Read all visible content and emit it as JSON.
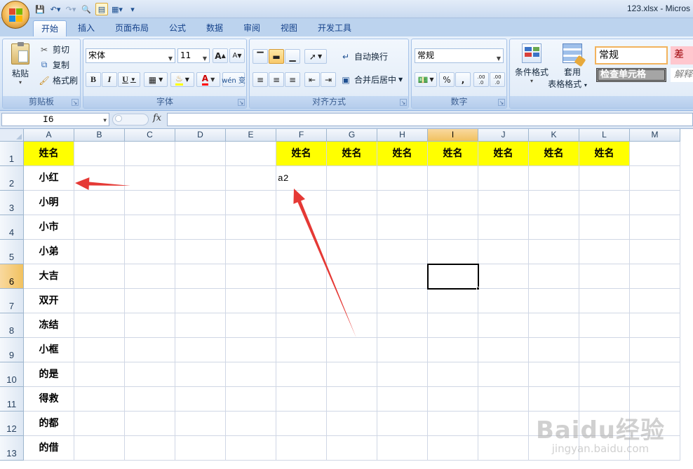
{
  "window": {
    "title": "123.xlsx - Micros"
  },
  "tabs": [
    "开始",
    "插入",
    "页面布局",
    "公式",
    "数据",
    "审阅",
    "视图",
    "开发工具"
  ],
  "active_tab": "开始",
  "ribbon": {
    "clipboard": {
      "label": "剪贴板",
      "paste": "粘贴",
      "cut": "剪切",
      "copy": "复制",
      "format_painter": "格式刷"
    },
    "font": {
      "label": "字体",
      "font_name": "宋体",
      "font_size": "11",
      "bold": "B",
      "italic": "I",
      "underline": "U",
      "font_color_glyph": "A",
      "phonetic_glyph": "wén 变",
      "grow_glyph": "A",
      "shrink_glyph": "A"
    },
    "alignment": {
      "label": "对齐方式",
      "wrap_text": "自动换行",
      "merge_center": "合并后居中"
    },
    "number": {
      "label": "数字",
      "format": "常规",
      "percent": "%",
      "comma": ",",
      "inc_decimal": ".00 .0",
      "dec_decimal": ".00 .0"
    },
    "styles": {
      "conditional_format": "条件格式",
      "format_table_1": "套用",
      "format_table_2": "表格格式",
      "style_normal": "常规",
      "style_bad": "差",
      "style_check": "检查单元格",
      "style_explain": "解释"
    }
  },
  "formula_bar": {
    "name_box": "I6",
    "fx": "fx",
    "content": ""
  },
  "sheet": {
    "columns": [
      "A",
      "B",
      "C",
      "D",
      "E",
      "F",
      "G",
      "H",
      "I",
      "J",
      "K",
      "L",
      "M"
    ],
    "selected_column": "I",
    "rows": [
      "1",
      "2",
      "3",
      "4",
      "5",
      "6",
      "7",
      "8",
      "9",
      "10",
      "11",
      "12",
      "13"
    ],
    "selected_row": "6",
    "header_value": "姓名",
    "header_columns": [
      "A",
      "F",
      "G",
      "H",
      "I",
      "J",
      "K",
      "L"
    ],
    "column_a": [
      "小红",
      "小明",
      "小市",
      "小弟",
      "大吉",
      "双开",
      "冻结",
      "小框",
      "的是",
      "得救",
      "的都",
      "的借"
    ],
    "f2_value": "a2",
    "active_cell": "I6"
  },
  "annotations": {
    "arrow_color": "#e53935"
  },
  "colors": {
    "header_fill": "#ffff00",
    "ribbon_tab": "#bcd3ee"
  },
  "watermark": {
    "text": "Baidu经验",
    "url": "jingyan.baidu.com"
  }
}
